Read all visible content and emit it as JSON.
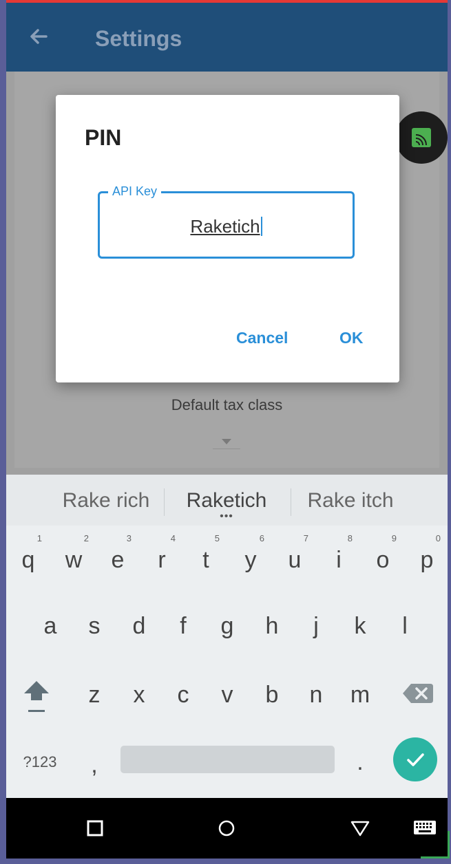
{
  "app": {
    "title": "Settings"
  },
  "background": {
    "default_tax_class_label": "Default tax class"
  },
  "dialog": {
    "title": "PIN",
    "field_label": "API Key",
    "field_value": "Raketich",
    "cancel_label": "Cancel",
    "ok_label": "OK"
  },
  "keyboard": {
    "suggestions": [
      "Rake rich",
      "Raketich",
      "Rake itch"
    ],
    "row1": [
      {
        "key": "q",
        "hint": "1"
      },
      {
        "key": "w",
        "hint": "2"
      },
      {
        "key": "e",
        "hint": "3"
      },
      {
        "key": "r",
        "hint": "4"
      },
      {
        "key": "t",
        "hint": "5"
      },
      {
        "key": "y",
        "hint": "6"
      },
      {
        "key": "u",
        "hint": "7"
      },
      {
        "key": "i",
        "hint": "8"
      },
      {
        "key": "o",
        "hint": "9"
      },
      {
        "key": "p",
        "hint": "0"
      }
    ],
    "row2": [
      "a",
      "s",
      "d",
      "f",
      "g",
      "h",
      "j",
      "k",
      "l"
    ],
    "row3": [
      "z",
      "x",
      "c",
      "v",
      "b",
      "n",
      "m"
    ],
    "symbols_label": "?123",
    "comma_label": ",",
    "period_label": "."
  },
  "colors": {
    "accent": "#2a8fd8",
    "app_bar": "#1f4e79",
    "enter_key": "#2bb5a3",
    "fab_icon": "#4caf50"
  },
  "icons": {
    "back": "arrow-left-icon",
    "fab": "cast-icon",
    "shift": "shift-icon",
    "backspace": "backspace-icon",
    "enter": "checkmark-icon",
    "nav_back": "triangle-down-icon",
    "nav_home": "circle-icon",
    "nav_recents": "square-icon",
    "nav_keyboard": "keyboard-icon"
  }
}
